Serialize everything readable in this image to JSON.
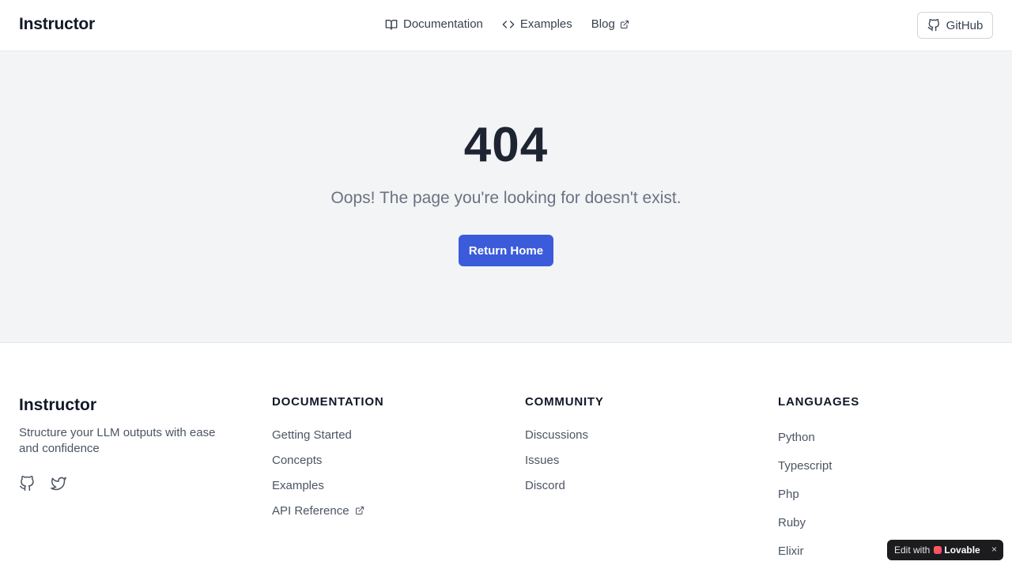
{
  "header": {
    "brand": "Instructor",
    "nav": [
      {
        "label": "Documentation",
        "icon": "book-icon"
      },
      {
        "label": "Examples",
        "icon": "code-icon"
      },
      {
        "label": "Blog",
        "icon": "external-link-icon"
      }
    ],
    "github_label": "GitHub"
  },
  "main": {
    "code": "404",
    "message": "Oops! The page you're looking for doesn't exist.",
    "button_label": "Return Home"
  },
  "footer": {
    "brand": "Instructor",
    "tagline": "Structure your LLM outputs with ease and confidence",
    "social": [
      "github-icon",
      "twitter-icon"
    ],
    "columns": [
      {
        "title": "DOCUMENTATION",
        "links": [
          "Getting Started",
          "Concepts",
          "Examples",
          "API Reference"
        ]
      },
      {
        "title": "COMMUNITY",
        "links": [
          "Discussions",
          "Issues",
          "Discord"
        ]
      },
      {
        "title": "LANGUAGES",
        "links": [
          "Python",
          "Typescript",
          "Php",
          "Ruby",
          "Elixir"
        ]
      }
    ]
  },
  "badge": {
    "prefix": "Edit with",
    "brand": "Lovable",
    "close": "×"
  },
  "colors": {
    "accent": "#3b5bdb",
    "main_bg": "#f3f4f6",
    "text": "#111827",
    "muted": "#6b7280"
  }
}
